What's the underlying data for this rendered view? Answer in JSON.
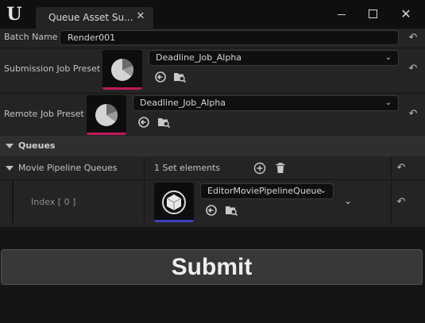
{
  "window": {
    "tab_title": "Queue Asset Su...",
    "close_glyph": "✕",
    "logo_glyph": "U"
  },
  "batch": {
    "label": "Batch Name",
    "value": "Render001"
  },
  "submission_preset": {
    "label": "Submission Job Preset",
    "value": "Deadline_Job_Alpha",
    "accent_color": "#c2185b"
  },
  "remote_preset": {
    "label": "Remote Job Preset",
    "value": "Deadline_Job_Alpha",
    "accent_color": "#c2185b"
  },
  "queues_section": {
    "label": "Queues"
  },
  "movie_pipeline": {
    "label": "Movie Pipeline Queues",
    "count_text": "1 Set elements",
    "index_label": "Index [ 0 ]",
    "value": "EditorMoviePipelineQueue",
    "accent_color": "#3f3fbf"
  },
  "submit": {
    "label": "Submit"
  },
  "icons": {
    "reset": "reset-to-default-icon",
    "browse": "browse-to-asset-icon",
    "find": "find-in-content-browser-icon",
    "add": "add-element-icon",
    "delete": "delete-element-icon"
  }
}
